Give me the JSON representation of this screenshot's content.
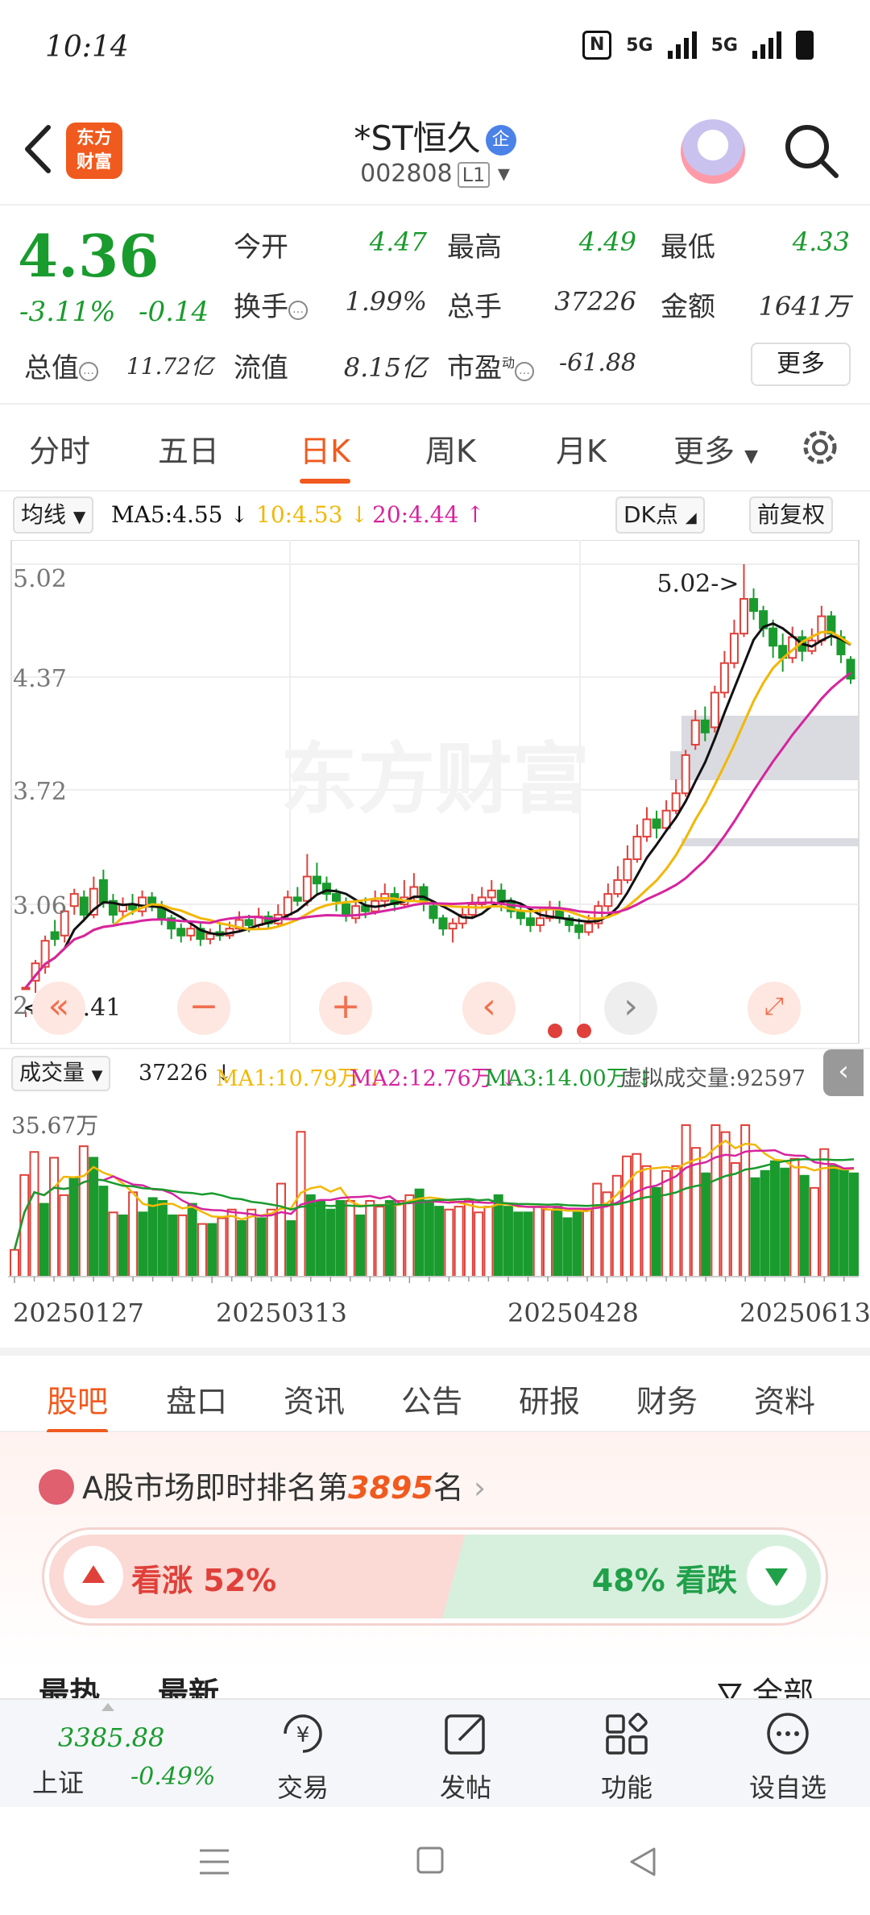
{
  "status": {
    "time": "10:14",
    "net1": "5G",
    "net2": "5G"
  },
  "header": {
    "logo_line1": "东方",
    "logo_line2": "财富",
    "name": "*ST恒久",
    "badge": "企",
    "code": "002808",
    "level": "L1"
  },
  "quote": {
    "price": "4.36",
    "change_pct": "-3.11%",
    "change": "-0.14",
    "labels": {
      "open": "今开",
      "high": "最高",
      "low": "最低",
      "turnover": "换手",
      "volume": "总手",
      "amount": "金额",
      "mcap": "总值",
      "float": "流值",
      "pe": "市盈"
    },
    "values": {
      "open": "4.47",
      "high": "4.49",
      "low": "4.33",
      "turnover": "1.99%",
      "volume": "37226",
      "amount": "1641万",
      "mcap": "11.72亿",
      "float": "8.15亿",
      "pe": "-61.88"
    },
    "pe_sup": "动",
    "more": "更多"
  },
  "periods": [
    "分时",
    "五日",
    "日K",
    "周K",
    "月K",
    "更多"
  ],
  "active_period": "日K",
  "ma_row": {
    "chip": "均线",
    "ma5": "MA5:4.55 ↓",
    "ma10": "10:4.53 ↓",
    "ma20": "20:4.44 ↑",
    "dk": "DK点",
    "adjust": "前复权"
  },
  "colors": {
    "up": "#e0403a",
    "down": "#1a9b2e",
    "ma5": "#111111",
    "ma10": "#f2b705",
    "ma20": "#d6249f",
    "accent": "#f05a1e"
  },
  "chart_data": {
    "type": "candlestick",
    "ylim": [
      2.41,
      5.02
    ],
    "ticks": [
      "5.02",
      "4.37",
      "3.72",
      "3.06",
      "2.41"
    ],
    "max_label": "5.02->",
    "min_label": "<---2.41",
    "watermark": "东方财富",
    "candles": [
      [
        2.58,
        2.58,
        2.44,
        2.41
      ],
      [
        2.62,
        2.72,
        2.74,
        2.55
      ],
      [
        2.7,
        2.85,
        2.88,
        2.66
      ],
      [
        2.9,
        2.86,
        2.97,
        2.82
      ],
      [
        2.88,
        3.02,
        3.05,
        2.84
      ],
      [
        3.05,
        3.12,
        3.15,
        3.0
      ],
      [
        3.1,
        3.0,
        3.14,
        2.96
      ],
      [
        3.0,
        3.15,
        3.22,
        2.98
      ],
      [
        3.2,
        3.07,
        3.26,
        3.04
      ],
      [
        3.08,
        3.0,
        3.12,
        2.95
      ],
      [
        3.02,
        3.06,
        3.1,
        2.98
      ],
      [
        3.06,
        3.03,
        3.12,
        3.0
      ],
      [
        3.02,
        3.1,
        3.14,
        2.99
      ],
      [
        3.1,
        3.05,
        3.13,
        3.02
      ],
      [
        3.05,
        2.98,
        3.08,
        2.94
      ],
      [
        2.98,
        2.92,
        3.0,
        2.86
      ],
      [
        2.92,
        2.88,
        2.95,
        2.84
      ],
      [
        2.88,
        2.92,
        2.96,
        2.85
      ],
      [
        2.92,
        2.86,
        2.95,
        2.82
      ],
      [
        2.86,
        2.89,
        2.92,
        2.83
      ],
      [
        2.9,
        2.88,
        2.95,
        2.85
      ],
      [
        2.88,
        2.92,
        2.96,
        2.86
      ],
      [
        2.92,
        2.97,
        3.02,
        2.9
      ],
      [
        2.97,
        2.94,
        3.0,
        2.9
      ],
      [
        2.94,
        2.99,
        3.04,
        2.92
      ],
      [
        2.99,
        2.95,
        3.02,
        2.92
      ],
      [
        2.95,
        3.0,
        3.06,
        2.94
      ],
      [
        3.0,
        3.1,
        3.14,
        2.98
      ],
      [
        3.1,
        3.08,
        3.16,
        3.05
      ],
      [
        3.08,
        3.22,
        3.35,
        3.05
      ],
      [
        3.22,
        3.18,
        3.3,
        3.12
      ],
      [
        3.18,
        3.12,
        3.22,
        3.08
      ],
      [
        3.12,
        3.08,
        3.15,
        3.02
      ],
      [
        3.06,
        3.0,
        3.1,
        2.96
      ],
      [
        2.98,
        3.05,
        3.08,
        2.95
      ],
      [
        3.05,
        3.02,
        3.1,
        2.98
      ],
      [
        3.02,
        3.08,
        3.14,
        3.0
      ],
      [
        3.08,
        3.12,
        3.18,
        3.04
      ],
      [
        3.12,
        3.06,
        3.16,
        3.02
      ],
      [
        3.06,
        3.1,
        3.2,
        3.04
      ],
      [
        3.1,
        3.16,
        3.24,
        3.08
      ],
      [
        3.16,
        3.08,
        3.18,
        3.02
      ],
      [
        3.05,
        2.98,
        3.08,
        2.95
      ],
      [
        2.98,
        2.92,
        3.0,
        2.88
      ],
      [
        2.92,
        2.95,
        2.98,
        2.84
      ],
      [
        2.95,
        3.0,
        3.05,
        2.92
      ],
      [
        3.0,
        3.06,
        3.12,
        2.98
      ],
      [
        3.06,
        3.1,
        3.16,
        3.04
      ],
      [
        3.1,
        3.14,
        3.2,
        3.06
      ],
      [
        3.14,
        3.08,
        3.18,
        3.02
      ],
      [
        3.08,
        3.02,
        3.1,
        2.98
      ],
      [
        3.02,
        2.98,
        3.06,
        2.94
      ],
      [
        2.98,
        2.94,
        3.02,
        2.9
      ],
      [
        2.94,
        2.98,
        3.04,
        2.9
      ],
      [
        2.98,
        3.03,
        3.08,
        2.96
      ],
      [
        3.03,
        2.98,
        3.08,
        2.95
      ],
      [
        2.98,
        2.94,
        3.0,
        2.9
      ],
      [
        2.94,
        2.9,
        2.98,
        2.86
      ],
      [
        2.9,
        2.95,
        3.0,
        2.88
      ],
      [
        2.95,
        3.05,
        3.08,
        2.92
      ],
      [
        3.05,
        3.12,
        3.18,
        3.02
      ],
      [
        3.12,
        3.2,
        3.28,
        3.1
      ],
      [
        3.2,
        3.32,
        3.4,
        3.18
      ],
      [
        3.32,
        3.45,
        3.52,
        3.3
      ],
      [
        3.45,
        3.55,
        3.62,
        3.42
      ],
      [
        3.55,
        3.5,
        3.6,
        3.44
      ],
      [
        3.5,
        3.6,
        3.66,
        3.48
      ],
      [
        3.6,
        3.7,
        3.78,
        3.58
      ],
      [
        3.7,
        3.92,
        3.95,
        3.68
      ],
      [
        3.98,
        4.12,
        4.18,
        3.95
      ],
      [
        4.12,
        4.05,
        4.2,
        4.0
      ],
      [
        4.08,
        4.28,
        4.32,
        4.05
      ],
      [
        4.28,
        4.45,
        4.52,
        4.25
      ],
      [
        4.45,
        4.62,
        4.7,
        4.42
      ],
      [
        4.62,
        4.82,
        5.02,
        4.6
      ],
      [
        4.82,
        4.75,
        4.88,
        4.7
      ],
      [
        4.75,
        4.65,
        4.78,
        4.6
      ],
      [
        4.65,
        4.55,
        4.7,
        4.48
      ],
      [
        4.55,
        4.48,
        4.62,
        4.4
      ],
      [
        4.48,
        4.6,
        4.66,
        4.45
      ],
      [
        4.6,
        4.52,
        4.64,
        4.46
      ],
      [
        4.52,
        4.58,
        4.65,
        4.5
      ],
      [
        4.58,
        4.72,
        4.78,
        4.55
      ],
      [
        4.72,
        4.62,
        4.75,
        4.55
      ],
      [
        4.6,
        4.5,
        4.64,
        4.45
      ],
      [
        4.47,
        4.36,
        4.49,
        4.33
      ]
    ]
  },
  "vol_row": {
    "chip": "成交量",
    "vol": "37226 ↓",
    "ma1": "MA1:10.79万 ↓",
    "ma2": "MA2:12.76万 ↓",
    "ma3": "MA3:14.00万 ↓",
    "virtual": "虚拟成交量:92597"
  },
  "vol_chart": {
    "max_label": "35.67万"
  },
  "dates": [
    "20250127",
    "20250313",
    "20250428",
    "20250613"
  ],
  "tabs": [
    "股吧",
    "盘口",
    "资讯",
    "公告",
    "研报",
    "财务",
    "资料"
  ],
  "active_tab": "股吧",
  "ranking": {
    "prefix": "A股市场即时排名第",
    "rank": "3895",
    "suffix": "名"
  },
  "sentiment": {
    "up_label": "看涨",
    "up_pct": "52%",
    "down_label": "看跌",
    "down_pct": "48%"
  },
  "peek": {
    "hot": "最热",
    "new": "最新",
    "all": "全部"
  },
  "bottom_bar": {
    "index_value": "3385.88",
    "index_name": "上证",
    "index_change": "-0.49%",
    "items": [
      "交易",
      "发帖",
      "功能",
      "设自选"
    ]
  }
}
